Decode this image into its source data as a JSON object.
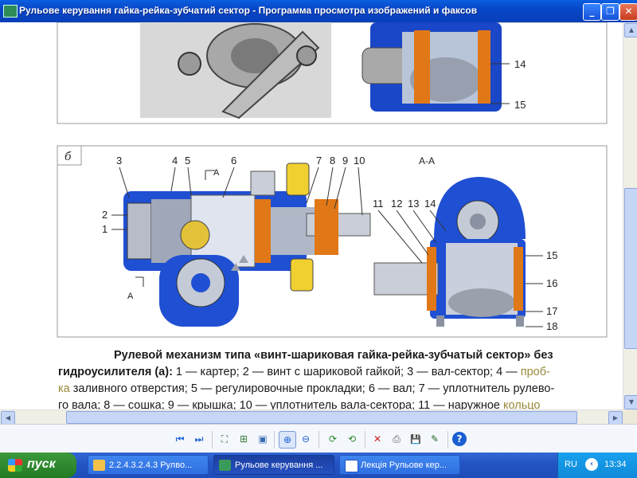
{
  "window": {
    "title": "Рульове керування  гайка-рейка-зубчатий сектор - Программа просмотра изображений и факсов",
    "minimize_glyph": "_",
    "restore_glyph": "❐",
    "close_glyph": "✕"
  },
  "figure": {
    "panel_label": "б",
    "section_label": "А-А",
    "callouts_top": [
      "14",
      "15"
    ],
    "callouts_left": [
      "3",
      "4",
      "5",
      "6",
      "7",
      "8",
      "9",
      "10",
      "2",
      "1"
    ],
    "callouts_right": [
      "11",
      "12",
      "13",
      "14",
      "15",
      "16",
      "17",
      "18"
    ],
    "section_marks": [
      "А",
      "А"
    ]
  },
  "caption": {
    "line1_bold": "Рулевой механизм типа «винт-шариковая гайка-рейка-зубчатый сектор» без",
    "line2_bold": "гидроусилителя (а):",
    "line2_rest": " 1 — картер; 2 — винт с шариковой гайкой; 3 — вал-сектор; 4 —",
    "line2_olive": " проб-",
    "line3_olive": "ка",
    "line3_rest": " заливного отверстия; 5 — регулировочные прокладки; 6 — вал; 7 — уплотнитель рулево-",
    "line4": "го  вала;  8 — сошка;  9 — крышка;  10 — уплотнитель вала-сектора;  11 — наружное",
    "line4_olive": "  кольцо"
  },
  "toolbar": {
    "tools": [
      {
        "name": "previous-image",
        "glyph": "⏮",
        "color": "#1a5fd0"
      },
      {
        "name": "next-image",
        "glyph": "⏭",
        "color": "#1a5fd0"
      },
      {
        "name": "best-fit",
        "glyph": "⛶",
        "color": "#3a7a3a"
      },
      {
        "name": "actual-size",
        "glyph": "⊞",
        "color": "#3a7a3a"
      },
      {
        "name": "slideshow",
        "glyph": "▣",
        "color": "#3a6ab0"
      },
      {
        "name": "zoom-in",
        "glyph": "⊕",
        "color": "#1a5fd0"
      },
      {
        "name": "zoom-out",
        "glyph": "⊖",
        "color": "#1a5fd0"
      },
      {
        "name": "rotate-clockwise",
        "glyph": "⟳",
        "color": "#2a8a2a"
      },
      {
        "name": "rotate-counterclockwise",
        "glyph": "⟲",
        "color": "#2a8a2a"
      },
      {
        "name": "delete",
        "glyph": "✕",
        "color": "#d02020"
      },
      {
        "name": "print",
        "glyph": "⎙",
        "color": "#555555"
      },
      {
        "name": "save",
        "glyph": "💾",
        "color": "#2a4a9a"
      },
      {
        "name": "edit",
        "glyph": "✎",
        "color": "#2a6a2a"
      },
      {
        "name": "help",
        "glyph": "?",
        "color": "#1a5fd0"
      }
    ]
  },
  "taskbar": {
    "start_label": "пуск",
    "tasks": [
      {
        "label": "2.2.4.3.2.4.3 Рулво...",
        "active": false
      },
      {
        "label": "Рульове керування ...",
        "active": true
      },
      {
        "label": "Лекція Рульове кер...",
        "active": false
      }
    ],
    "language": "RU",
    "clock": "13:34"
  }
}
